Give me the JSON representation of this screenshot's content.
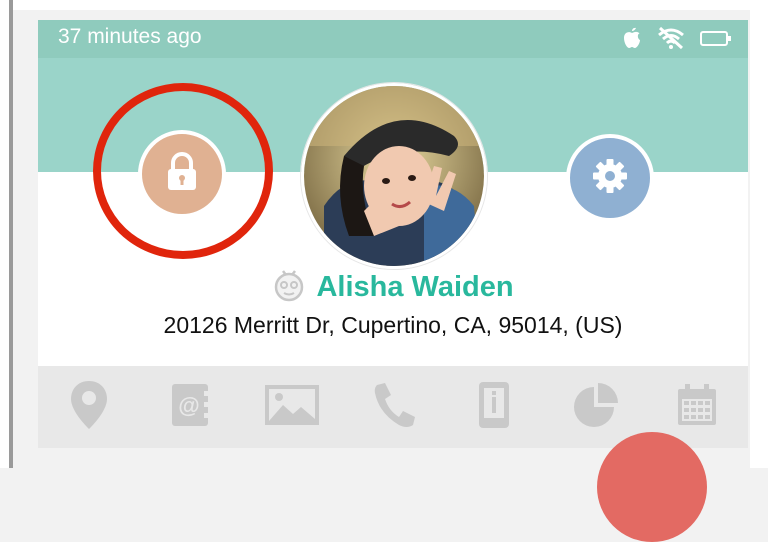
{
  "status_bar": {
    "time_ago": "37 minutes ago",
    "icons": [
      "apple-icon",
      "wifi-off-icon",
      "battery-icon"
    ]
  },
  "profile": {
    "name": "Alisha Waiden",
    "address": "20126 Merritt Dr, Cupertino, CA, 95014, (US)",
    "avatar": "profile-photo",
    "status_icon": "robot-face-icon"
  },
  "header_actions": {
    "left": "lock-icon",
    "right": "gear-icon",
    "highlighted": "lock-button"
  },
  "bottom_nav": {
    "items": [
      "location-pin-icon",
      "contact-book-icon",
      "image-icon",
      "phone-icon",
      "device-info-icon",
      "pie-chart-icon",
      "calendar-icon"
    ]
  },
  "colors": {
    "status_bar": "#8fcbbd",
    "header": "#9ad4c9",
    "lock_button": "#e0b192",
    "settings_button": "#8fb0d2",
    "name_text": "#29b89d",
    "highlight": "#e0250c",
    "nav_bar": "#e8e8e8",
    "fab": "#e36a63"
  }
}
